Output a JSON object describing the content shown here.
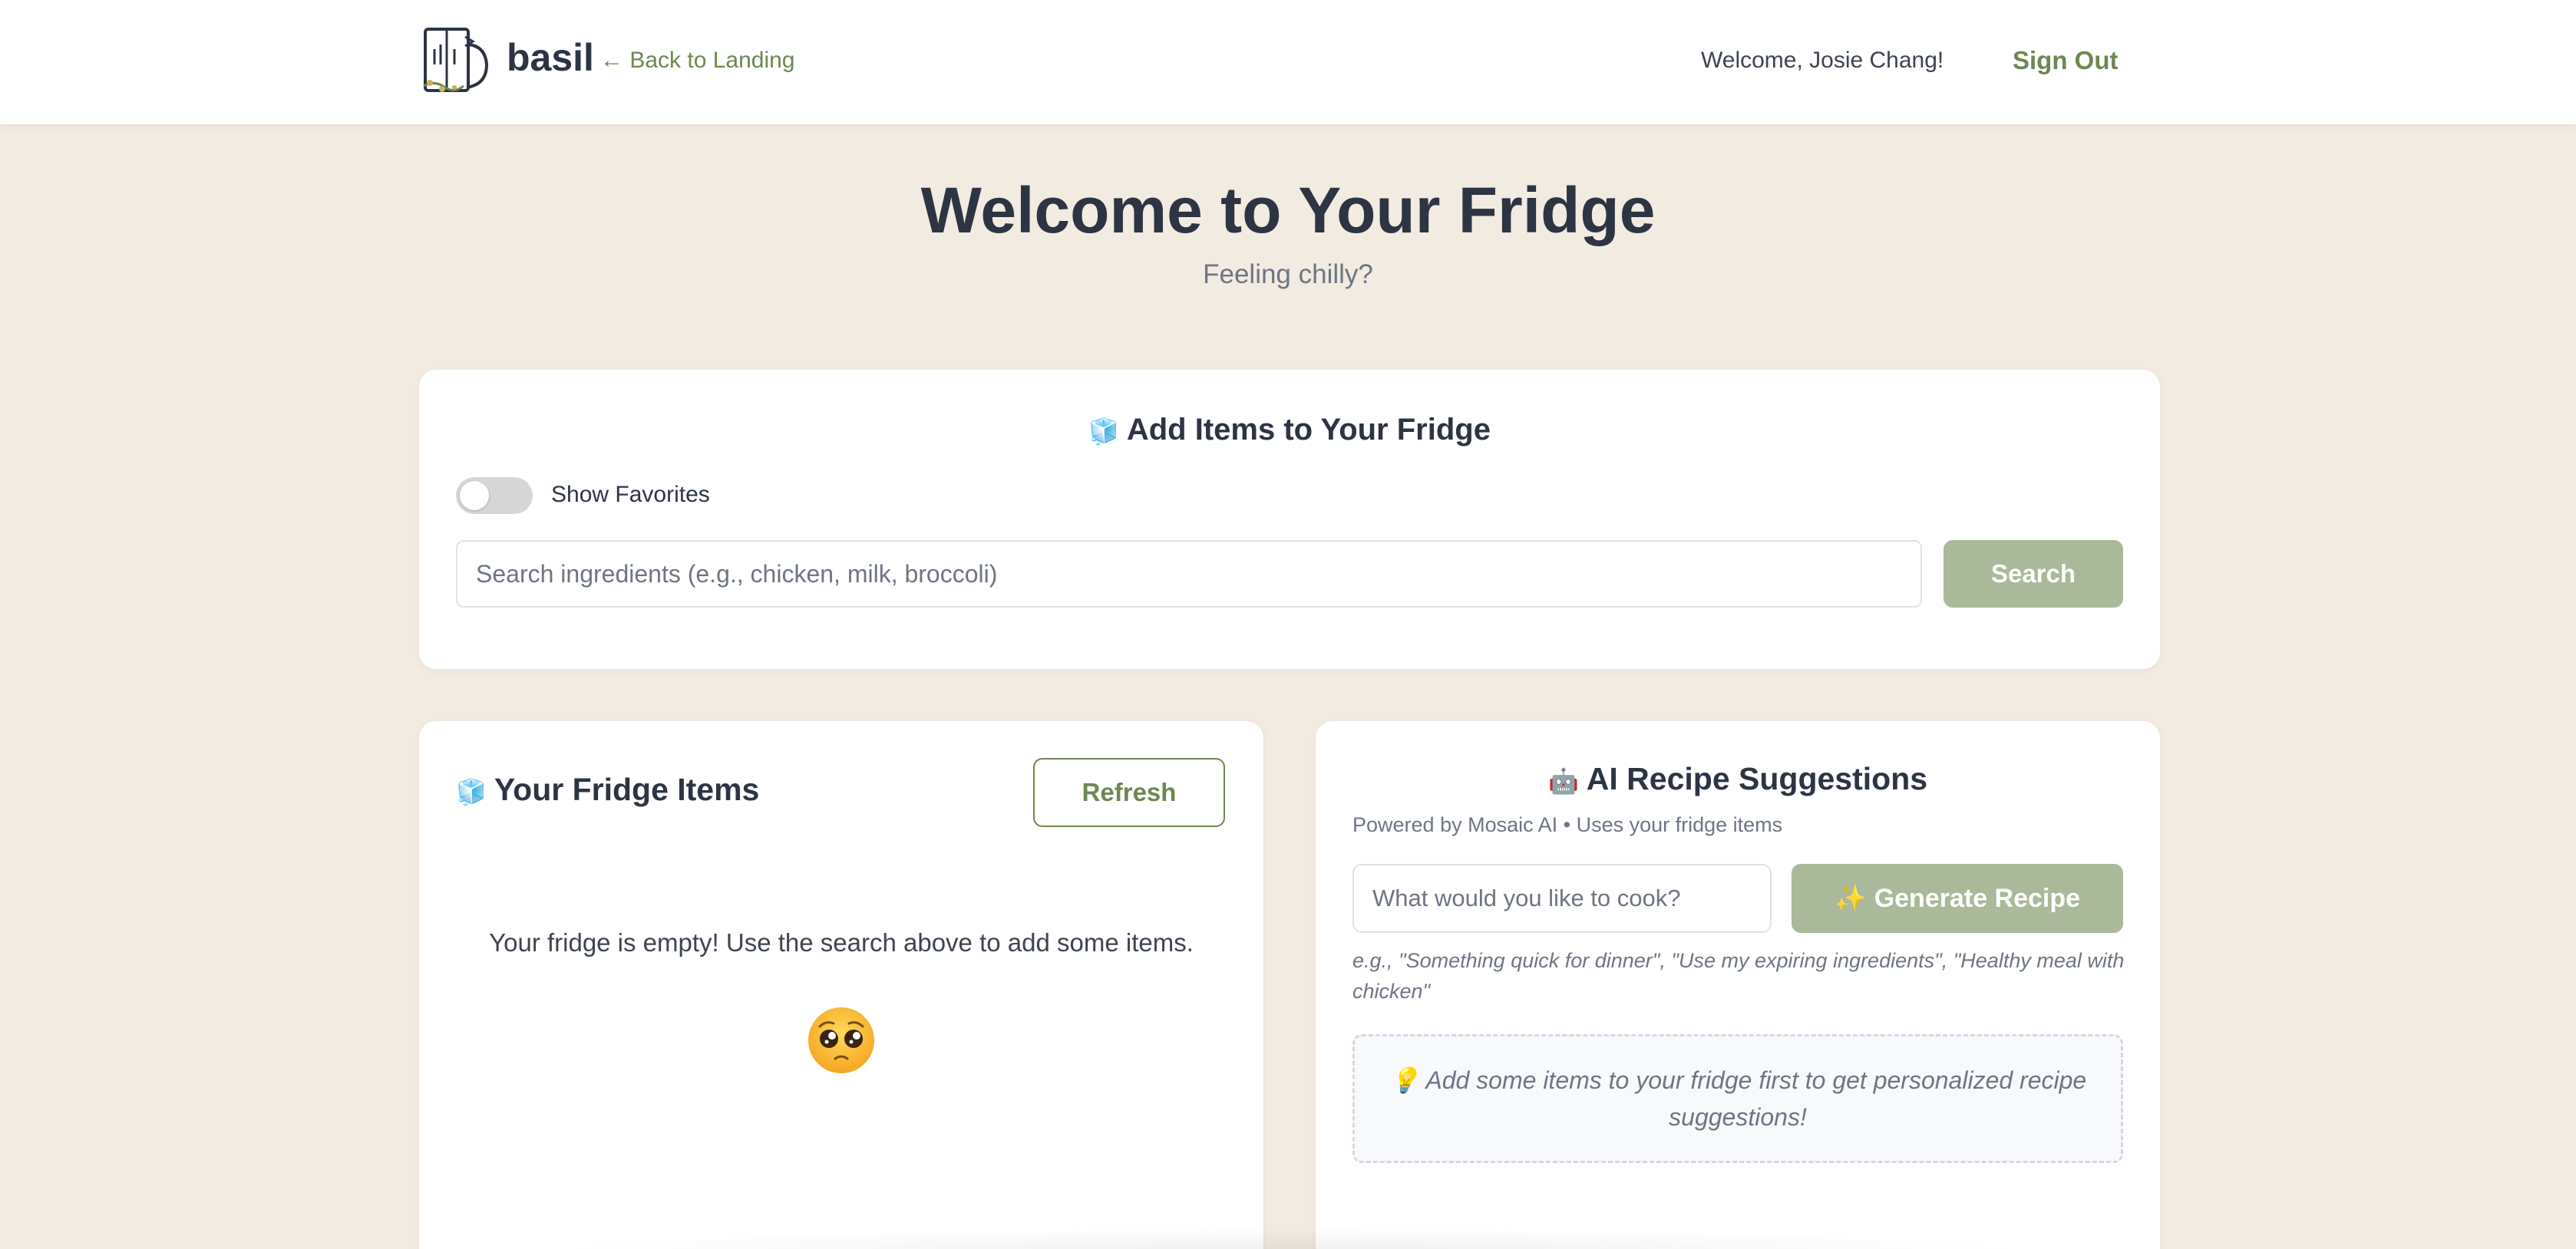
{
  "header": {
    "brand": "basil",
    "back_link": "← Back to Landing",
    "welcome": "Welcome, Josie Chang!",
    "signout": "Sign Out"
  },
  "hero": {
    "title": "Welcome to Your Fridge",
    "subtitle": "Feeling chilly?"
  },
  "add_card": {
    "icon": "ice-cube-icon",
    "title": "Add Items to Your Fridge",
    "toggle_label": "Show Favorites",
    "toggle_on": false,
    "search_placeholder": "Search ingredients (e.g., chicken, milk, broccoli)",
    "search_button": "Search"
  },
  "fridge_card": {
    "icon": "ice-cube-icon",
    "title": "Your Fridge Items",
    "refresh_button": "Refresh",
    "empty_message": "Your fridge is empty! Use the search above to add some items.",
    "empty_emoji": "pleading-face-emoji"
  },
  "ai_card": {
    "icon": "robot-icon",
    "title": "AI Recipe Suggestions",
    "powered_by": "Powered by Mosaic AI • Uses your fridge items",
    "input_placeholder": "What would you like to cook?",
    "generate_button": "✨ Generate Recipe",
    "examples": "e.g., \"Something quick for dinner\", \"Use my expiring ingredients\", \"Healthy meal with chicken\"",
    "tip": "💡 Add some items to your fridge first to get personalized recipe suggestions!"
  },
  "colors": {
    "background": "#f2ebe1",
    "accent": "#6f8750",
    "button_disabled": "#abb99b",
    "text": "#2d3443"
  }
}
